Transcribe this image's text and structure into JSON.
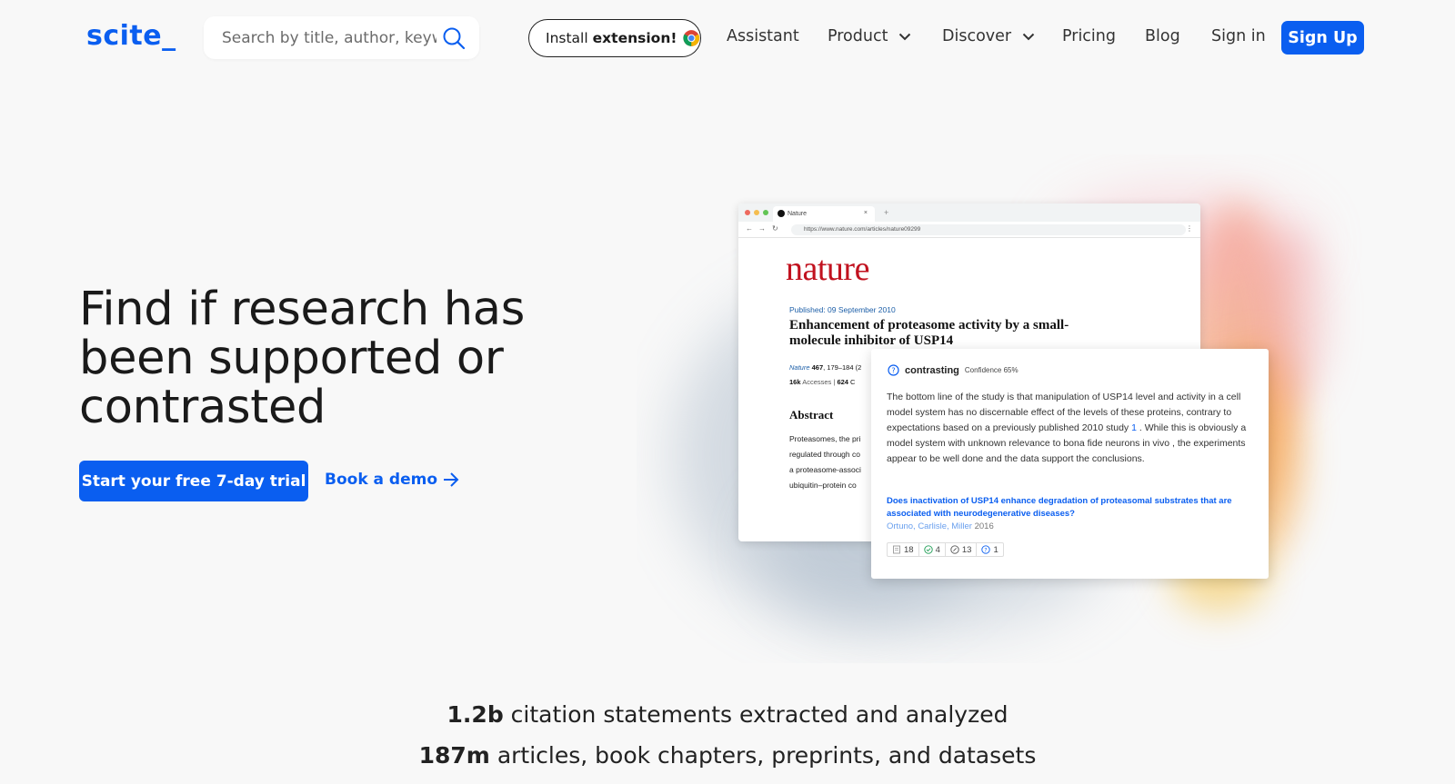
{
  "nav": {
    "logo": "scite_",
    "search_placeholder": "Search by title, author, keyword or doi",
    "install_prefix": "Install",
    "install_bold": "extension!",
    "links": {
      "assistant": "Assistant",
      "product": "Product",
      "discover": "Discover",
      "pricing": "Pricing",
      "blog": "Blog",
      "signin": "Sign in"
    },
    "signup": "Sign Up"
  },
  "hero": {
    "title": "Find if research has been supported or contrasted",
    "trial_cta": "Start your free 7-day trial",
    "demo_cta": "Book a demo"
  },
  "illustration": {
    "browser": {
      "tab_title": "Nature",
      "url": "https://www.nature.com/articles/nature09299",
      "journal_logo": "nature",
      "published": "Published: 09 September 2010",
      "article_title": "Enhancement of proteasome activity by a small-molecule inhibitor of USP14",
      "journal": "Nature",
      "volume": "467",
      "pages": ", 179–184 (2",
      "accesses_value": "16k",
      "accesses_label": "Accesses",
      "citations_value": "624",
      "citations_rest": "C",
      "abstract_heading": "Abstract",
      "abstract_lines": [
        "Proteasomes, the pri",
        "regulated through co",
        "a proteasome-associ",
        "ubiquitin–protein co"
      ]
    },
    "citation_card": {
      "label": "contrasting",
      "confidence": "Confidence 65%",
      "body_1": "The bottom line of the study is that manipulation of USP14 level and activity in a cell model system has no discernable effect of the levels of these proteins, contrary to expectations based on a previously published 2010 study ",
      "ref": "1",
      "body_2": " . While this is obviously a model system with unknown relevance to bona fide neurons in vivo , the experiments appear to be well done and the data support the conclusions.",
      "link": "Does inactivation of USP14 enhance degradation of proteasomal substrates that are associated with neurodegenerative diseases?",
      "authors": "Ortuno, Carlisle, Miller",
      "year": "2016",
      "tally": {
        "total": "18",
        "supporting": "4",
        "mentioning": "13",
        "contrasting": "1"
      }
    }
  },
  "stats": {
    "line1_num": "1.2b",
    "line1_text": " citation statements extracted and analyzed",
    "line2_num": "187m",
    "line2_text": " articles, book chapters, preprints, and datasets"
  },
  "colors": {
    "brand_blue": "#0a5ef0",
    "nature_red": "#c1121f",
    "background": "#f8f8f8"
  },
  "icons": [
    "search-icon",
    "chrome-icon",
    "chevron-down-icon",
    "arrow-right-icon",
    "question-circle-icon",
    "check-circle-icon",
    "slash-circle-icon"
  ]
}
